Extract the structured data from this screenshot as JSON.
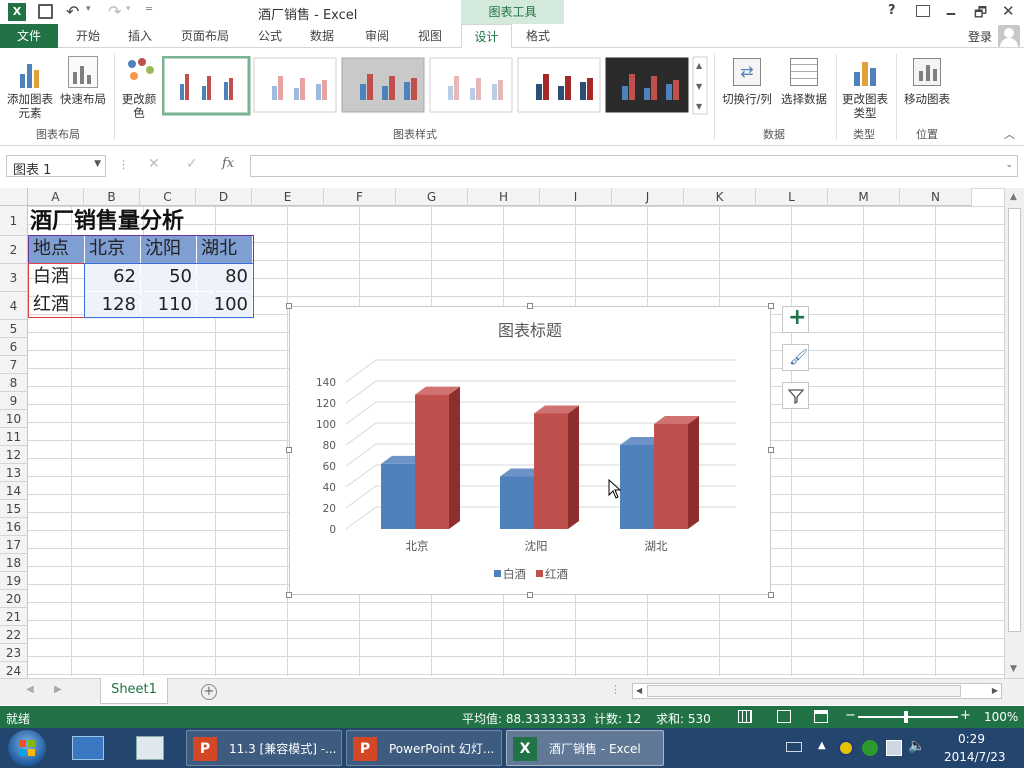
{
  "title": {
    "window_title": "酒厂销售 - Excel",
    "context_tab_group": "图表工具",
    "help": "?",
    "minimize": "🗕",
    "restore": "🗗",
    "close": "✕"
  },
  "ribbon_tabs": [
    "开始",
    "插入",
    "页面布局",
    "公式",
    "数据",
    "审阅",
    "视图",
    "设计",
    "格式"
  ],
  "file_tab": "文件",
  "signin": "登录",
  "ribbon": {
    "add_element": "添加图表元素",
    "quick_layout": "快速布局",
    "change_colors": "更改颜色",
    "switch_rowcol": "切换行/列",
    "select_data": "选择数据",
    "change_type": "更改图表类型",
    "move_chart": "移动图表",
    "group_layout": "图表布局",
    "group_styles": "图表样式",
    "group_data": "数据",
    "group_type": "类型",
    "group_location": "位置"
  },
  "formula_bar": {
    "name_box": "图表 1",
    "fx": "fx",
    "formula": ""
  },
  "columns": [
    "A",
    "B",
    "C",
    "D",
    "E",
    "F",
    "G",
    "H",
    "I",
    "J",
    "K",
    "L",
    "M",
    "N"
  ],
  "rows": [
    "1",
    "2",
    "3",
    "4",
    "5",
    "6",
    "7",
    "8",
    "9",
    "10",
    "11",
    "12",
    "13",
    "14",
    "15",
    "16",
    "17",
    "18",
    "19",
    "20",
    "21",
    "22",
    "23",
    "24"
  ],
  "table": {
    "title": "酒厂销售量分析",
    "header": [
      "地点",
      "北京",
      "沈阳",
      "湖北"
    ],
    "rows": [
      [
        "白酒",
        "62",
        "50",
        "80"
      ],
      [
        "红酒",
        "128",
        "110",
        "100"
      ]
    ]
  },
  "chart_data": {
    "type": "bar",
    "title": "图表标题",
    "categories": [
      "北京",
      "沈阳",
      "湖北"
    ],
    "series": [
      {
        "name": "白酒",
        "values": [
          62,
          50,
          80
        ],
        "color": "#4f81bd"
      },
      {
        "name": "红酒",
        "values": [
          128,
          110,
          100
        ],
        "color": "#c0504d"
      }
    ],
    "ylim": [
      0,
      140
    ],
    "yticks": [
      "0",
      "20",
      "40",
      "60",
      "80",
      "100",
      "120",
      "140"
    ],
    "legend": "bottom",
    "grid": true
  },
  "sheet_tabs": {
    "active": "Sheet1"
  },
  "status": {
    "ready": "就绪",
    "average": "平均值: 88.33333333",
    "count": "计数: 12",
    "sum": "求和: 530",
    "zoom": "100%"
  },
  "taskbar": {
    "item1": "11.3 [兼容模式] -...",
    "item2": "PowerPoint 幻灯...",
    "item3": "酒厂销售 - Excel",
    "time": "0:29",
    "date": "2014/7/23"
  }
}
